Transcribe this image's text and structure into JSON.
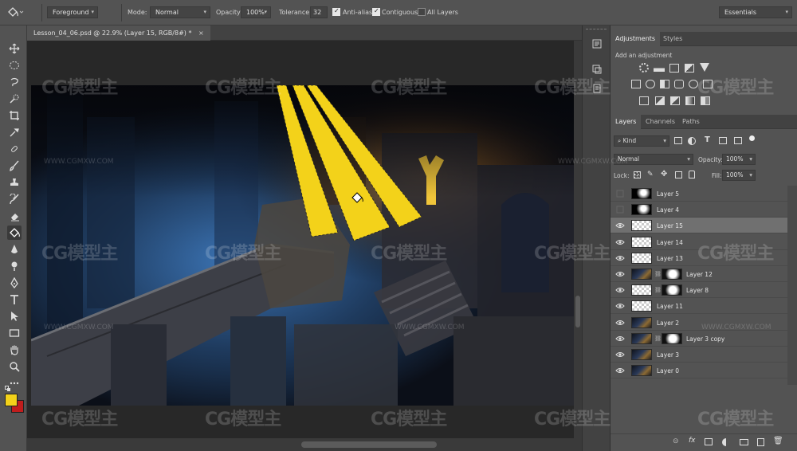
{
  "options_bar": {
    "preset": "Foreground",
    "mode_label": "Mode:",
    "mode_value": "Normal",
    "opacity_label": "Opacity:",
    "opacity_value": "100%",
    "tolerance_label": "Tolerance:",
    "tolerance_value": "32",
    "anti_alias_label": "Anti-alias",
    "contiguous_label": "Contiguous",
    "all_layers_label": "All Layers",
    "workspace": "Essentials"
  },
  "document": {
    "tab_title": "Lesson_04_06.psd @ 22.9% (Layer 15, RGB/8#) *",
    "close_glyph": "×"
  },
  "adjustments_panel": {
    "tabs": [
      "Adjustments",
      "Styles"
    ],
    "subtitle": "Add an adjustment"
  },
  "layers_panel": {
    "tabs": [
      "Layers",
      "Channels",
      "Paths"
    ],
    "filter_kind": "Kind",
    "blend_mode": "Normal",
    "opacity_label": "Opacity:",
    "opacity_value": "100%",
    "lock_label": "Lock:",
    "fill_label": "Fill:",
    "fill_value": "100%",
    "layers": [
      {
        "name": "Layer 5",
        "visible": false,
        "thumb": "bw"
      },
      {
        "name": "Layer 4",
        "visible": false,
        "thumb": "bw"
      },
      {
        "name": "Layer 15",
        "visible": true,
        "thumb": "checker",
        "selected": true
      },
      {
        "name": "Layer 14",
        "visible": true,
        "thumb": "checker"
      },
      {
        "name": "Layer 13",
        "visible": true,
        "thumb": "checker"
      },
      {
        "name": "Layer 12",
        "visible": true,
        "thumb": "dark",
        "mask": true
      },
      {
        "name": "Layer 8",
        "visible": true,
        "thumb": "checker",
        "mask": true
      },
      {
        "name": "Layer 11",
        "visible": true,
        "thumb": "checker"
      },
      {
        "name": "Layer 2",
        "visible": true,
        "thumb": "dark"
      },
      {
        "name": "Layer 3 copy",
        "visible": true,
        "thumb": "dark",
        "mask": true
      },
      {
        "name": "Layer 3",
        "visible": true,
        "thumb": "dark"
      },
      {
        "name": "Layer 0",
        "visible": true,
        "thumb": "dark"
      }
    ]
  },
  "colors": {
    "foreground": "#f3d21a",
    "background": "#c01d1d",
    "ui_dark": "#424242",
    "ui_mid": "#535353",
    "selection": "#707070"
  },
  "watermark": {
    "logo_text": "CG模型主",
    "url_text": "WWW.CGMXW.COM"
  }
}
